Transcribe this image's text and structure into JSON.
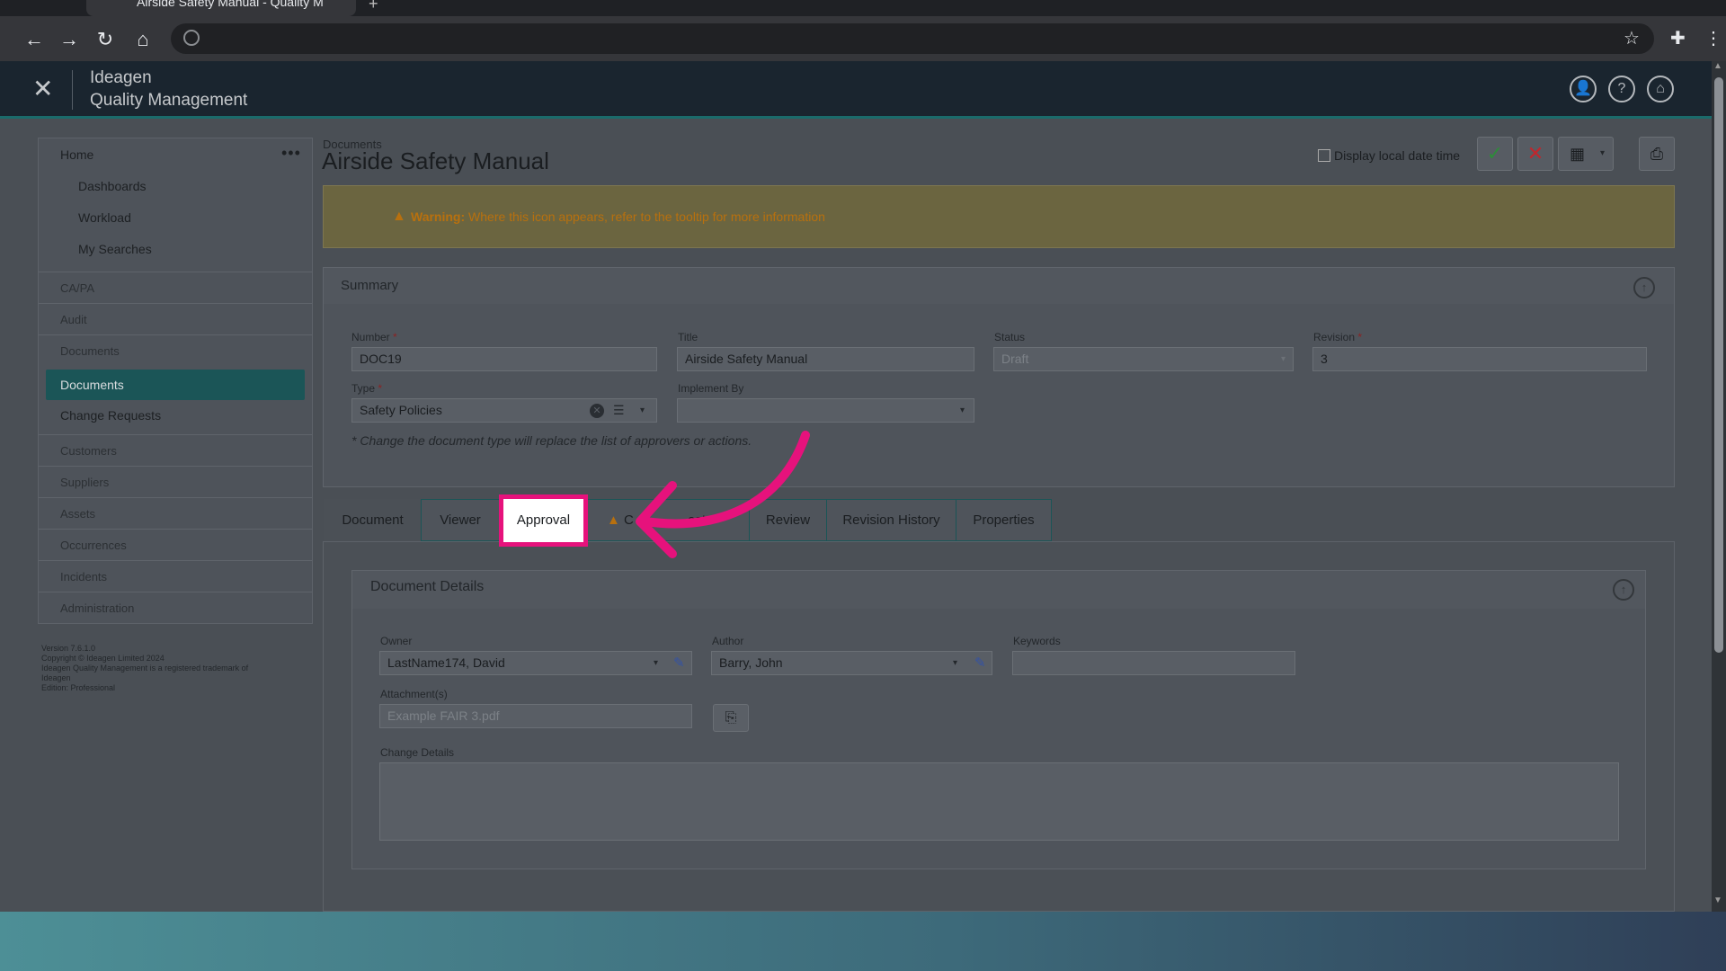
{
  "browser": {
    "tab_title": "Airside Safety Manual - Quality M",
    "new_tab": "+"
  },
  "header": {
    "brand_line1": "Ideagen",
    "brand_line2": "Quality Management"
  },
  "sidebar": {
    "home": "Home",
    "home_items": [
      "Dashboards",
      "Workload",
      "My Searches"
    ],
    "categories": [
      "CA/PA",
      "Audit",
      "Documents"
    ],
    "documents_active": "Documents",
    "change_requests": "Change Requests",
    "more_categories": [
      "Customers",
      "Suppliers",
      "Assets",
      "Occurrences",
      "Incidents",
      "Administration"
    ],
    "version_lines": [
      "Version 7.6.1.0",
      "Copyright © Ideagen Limited 2024",
      "Ideagen Quality Management is a registered trademark of",
      "Ideagen",
      "Edition: Professional"
    ]
  },
  "page": {
    "breadcrumb": "Documents",
    "title": "Airside Safety Manual",
    "display_local_date_time": "Display local date time"
  },
  "warning": {
    "label": "Warning:",
    "text": "Where this icon appears, refer to the tooltip for more information"
  },
  "summary": {
    "title": "Summary",
    "number_label": "Number",
    "number_value": "DOC19",
    "title_label": "Title",
    "title_value": "Airside Safety Manual",
    "status_label": "Status",
    "status_value": "Draft",
    "revision_label": "Revision",
    "revision_value": "3",
    "type_label": "Type",
    "type_value": "Safety Policies",
    "implement_by_label": "Implement By",
    "implement_by_value": "",
    "required_marker": "*",
    "note": "* Change the document type will replace the list of approvers or actions."
  },
  "tabs": {
    "document": "Document",
    "viewer": "Viewer",
    "approval": "Approval",
    "obscured_a": "C",
    "obscured_b": "ests",
    "review": "Review",
    "revision_history": "Revision History",
    "properties": "Properties"
  },
  "document_details": {
    "title": "Document Details",
    "owner_label": "Owner",
    "owner_value": "LastName174, David",
    "author_label": "Author",
    "author_value": "Barry, John",
    "keywords_label": "Keywords",
    "keywords_value": "",
    "attachments_label": "Attachment(s)",
    "attachments_value": "Example FAIR 3.pdf",
    "change_details_label": "Change Details",
    "change_details_value": ""
  },
  "colors": {
    "highlight": "#e6127c",
    "active_nav": "#1b5557",
    "warning_text": "#b8700e",
    "approve": "#2e8b3a",
    "reject": "#c0262d"
  }
}
